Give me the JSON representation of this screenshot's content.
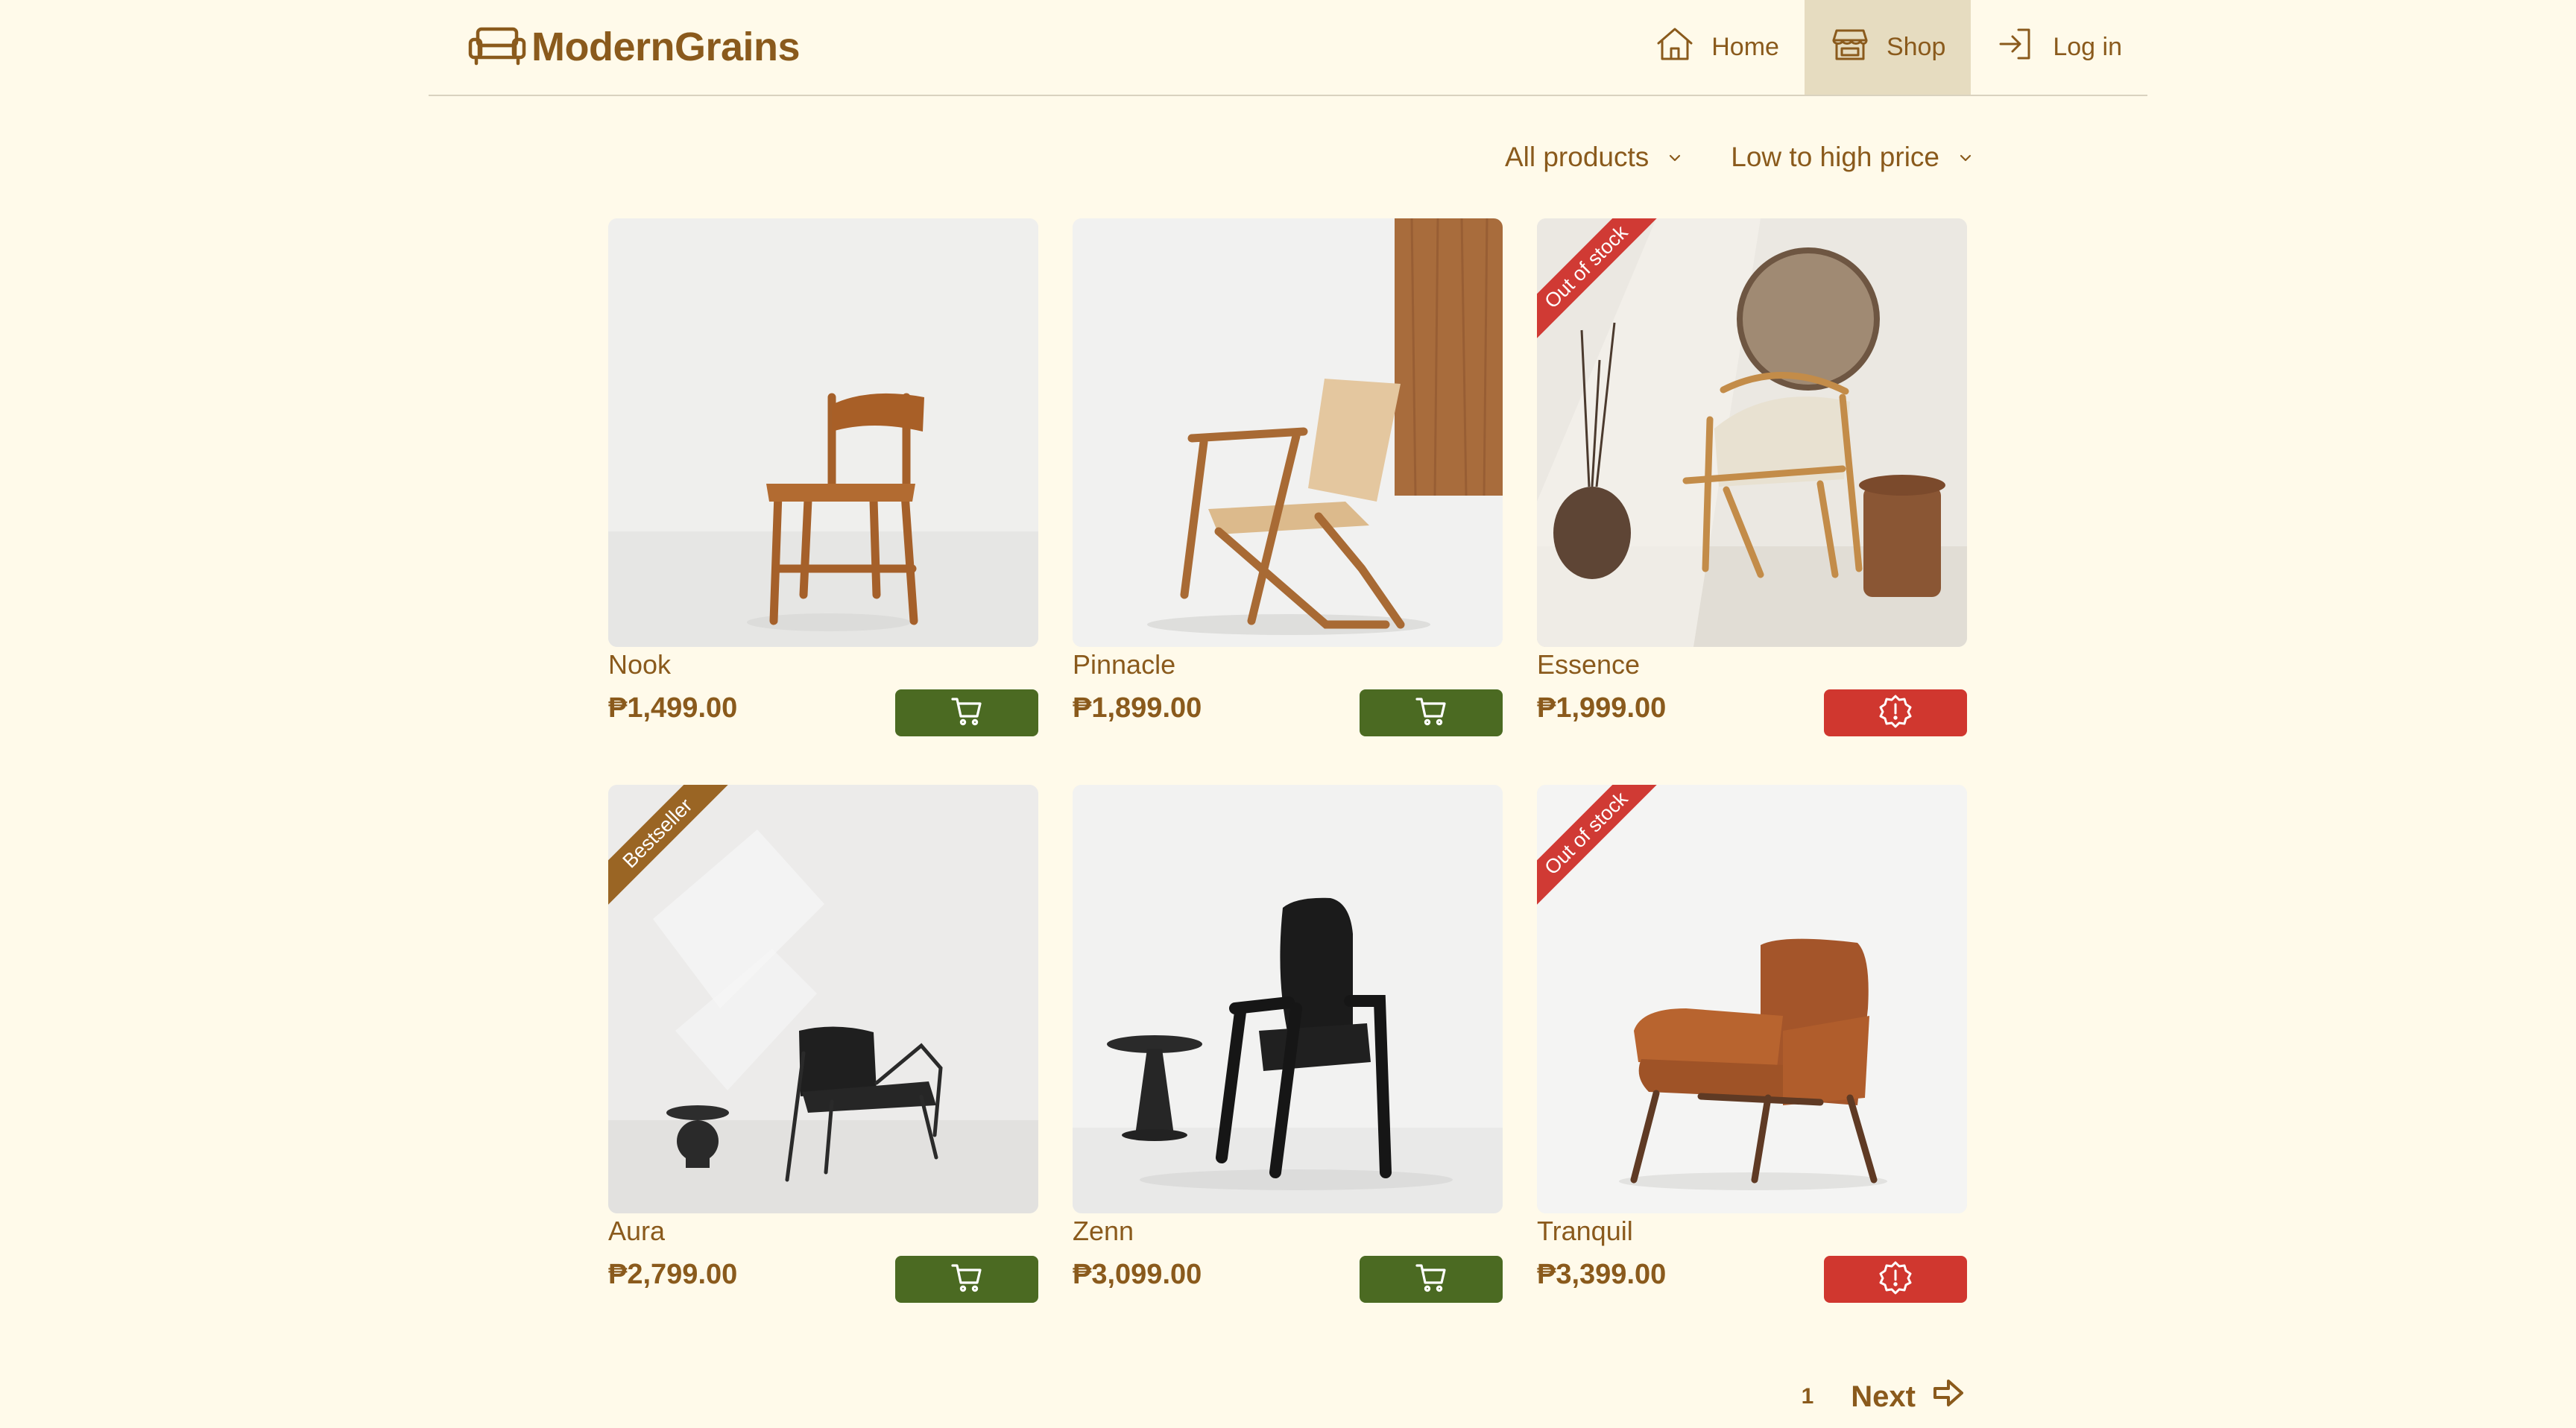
{
  "brand": {
    "name": "ModernGrains"
  },
  "nav": {
    "home": "Home",
    "shop": "Shop",
    "login": "Log in",
    "active": "Shop"
  },
  "filters": {
    "category": "All products",
    "sort": "Low to high price"
  },
  "colors": {
    "background": "#fffaea",
    "accent_brown": "#8a5a1c",
    "cart_green": "#4b6a22",
    "alert_red": "#d0372f",
    "active_nav": "#e6dcc0"
  },
  "products": [
    {
      "name": "Nook",
      "price": "₱1,499.00",
      "action": "cart"
    },
    {
      "name": "Pinnacle",
      "price": "₱1,899.00",
      "action": "cart"
    },
    {
      "name": "Essence",
      "price": "₱1,999.00",
      "action": "alert",
      "badge": "Out of stock"
    },
    {
      "name": "Aura",
      "price": "₱2,799.00",
      "action": "cart",
      "badge": "Bestseller"
    },
    {
      "name": "Zenn",
      "price": "₱3,099.00",
      "action": "cart"
    },
    {
      "name": "Tranquil",
      "price": "₱3,399.00",
      "action": "alert",
      "badge": "Out of stock"
    }
  ],
  "pagination": {
    "page": "1",
    "next": "Next"
  },
  "icons": {
    "brand": "sofa-icon",
    "home": "house-icon",
    "shop": "storefront-icon",
    "login": "login-arrow-icon",
    "dropdown": "chevron-down-icon",
    "cart": "cart-icon",
    "alert": "alert-badge-icon",
    "next": "arrow-right-icon"
  }
}
